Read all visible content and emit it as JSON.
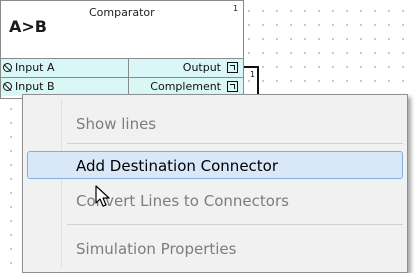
{
  "block": {
    "symbol": "A>B",
    "title": "Comparator",
    "number": "1",
    "inputs": [
      {
        "label": "Input A"
      },
      {
        "label": "Input B"
      }
    ],
    "outputs": [
      {
        "label": "Output"
      },
      {
        "label": "Complement"
      }
    ]
  },
  "wire": {
    "label": "1"
  },
  "context_menu": {
    "items": [
      {
        "label": "Show lines",
        "enabled": false
      },
      {
        "label": "Add Destination Connector",
        "enabled": true,
        "highlighted": true
      },
      {
        "label": "Convert Lines to Connectors",
        "enabled": false
      },
      {
        "label": "Simulation Properties",
        "enabled": false
      }
    ]
  },
  "colors": {
    "port_row_bg": "#d9f7f6",
    "menu_bg": "#f1f1f1",
    "highlight_bg": "#d8e8f9",
    "highlight_border": "#84acdd",
    "disabled_text": "#7d7d7d"
  }
}
